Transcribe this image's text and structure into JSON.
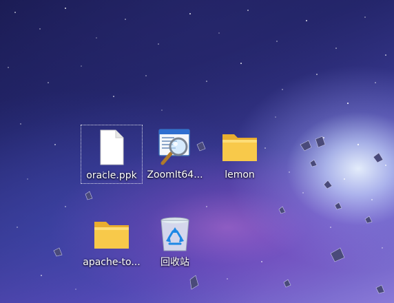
{
  "desktop": {
    "icons": [
      {
        "label": "oracle.ppk",
        "icon": "blank-file-icon",
        "selected": true
      },
      {
        "label": "ZoomIt64...",
        "icon": "zoomit-magnifier-icon",
        "selected": false
      },
      {
        "label": "lemon",
        "icon": "folder-icon",
        "selected": false
      },
      {
        "label": "apache-to...",
        "icon": "folder-icon",
        "selected": false
      },
      {
        "label": "回收站",
        "icon": "recycle-bin-icon",
        "selected": false
      }
    ]
  },
  "colors": {
    "label_text": "#ffffff",
    "folder_yellow": "#f8c94a",
    "folder_light": "#ffe58a",
    "recycle_blue": "#1e88e5"
  }
}
